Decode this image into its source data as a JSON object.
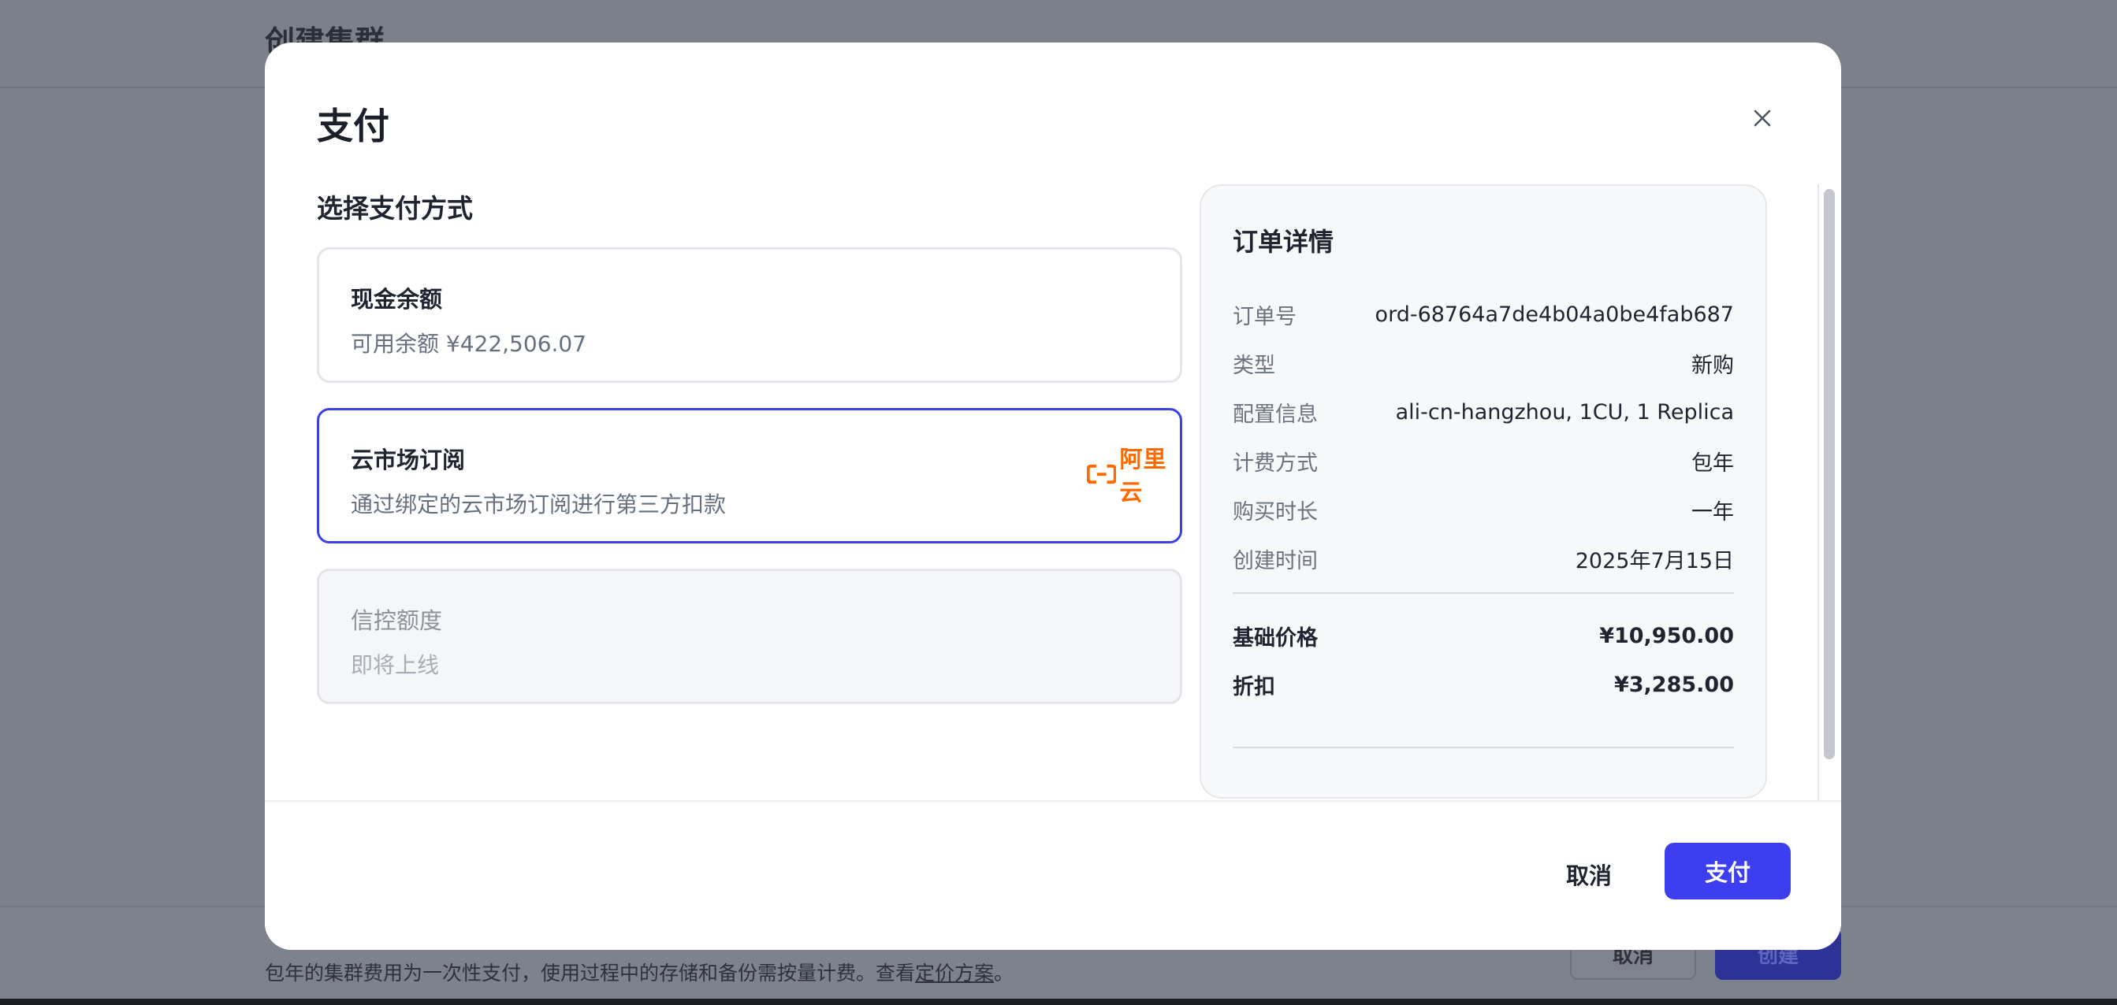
{
  "background": {
    "page_title": "创建集群",
    "footer_note_prefix": "包年的集群费用为一次性支付，使用过程中的存储和备份需按量计费。查看",
    "footer_note_link": "定价方案",
    "footer_note_suffix": "。",
    "cancel_label": "取消",
    "create_label": "创建"
  },
  "modal": {
    "title": "支付",
    "section_title": "选择支付方式",
    "payment_options": [
      {
        "title": "现金余额",
        "subtitle": "可用余额 ¥422,506.07",
        "selected": false,
        "disabled": false
      },
      {
        "title": "云市场订阅",
        "subtitle": "通过绑定的云市场订阅进行第三方扣款",
        "selected": true,
        "disabled": false,
        "logo_text": "阿里云",
        "logo_icon": "aliyun-logo-icon"
      },
      {
        "title": "信控额度",
        "subtitle": "即将上线",
        "selected": false,
        "disabled": true
      }
    ],
    "order": {
      "title": "订单详情",
      "rows": [
        {
          "key": "订单号",
          "value": "ord-68764a7de4b04a0be4fab687"
        },
        {
          "key": "类型",
          "value": "新购"
        },
        {
          "key": "配置信息",
          "value": "ali-cn-hangzhou, 1CU, 1 Replica"
        },
        {
          "key": "计费方式",
          "value": "包年"
        },
        {
          "key": "购买时长",
          "value": "一年"
        },
        {
          "key": "创建时间",
          "value": "2025年7月15日"
        }
      ],
      "prices": [
        {
          "key": "基础价格",
          "value": "¥10,950.00"
        },
        {
          "key": "折扣",
          "value": "¥3,285.00"
        }
      ]
    },
    "footer": {
      "cancel_label": "取消",
      "pay_label": "支付"
    }
  },
  "colors": {
    "accent": "#3d3ef0",
    "selected_border": "#3d3fe0",
    "aliyun_orange": "#ff6a00",
    "overlay": "#7b808a"
  }
}
